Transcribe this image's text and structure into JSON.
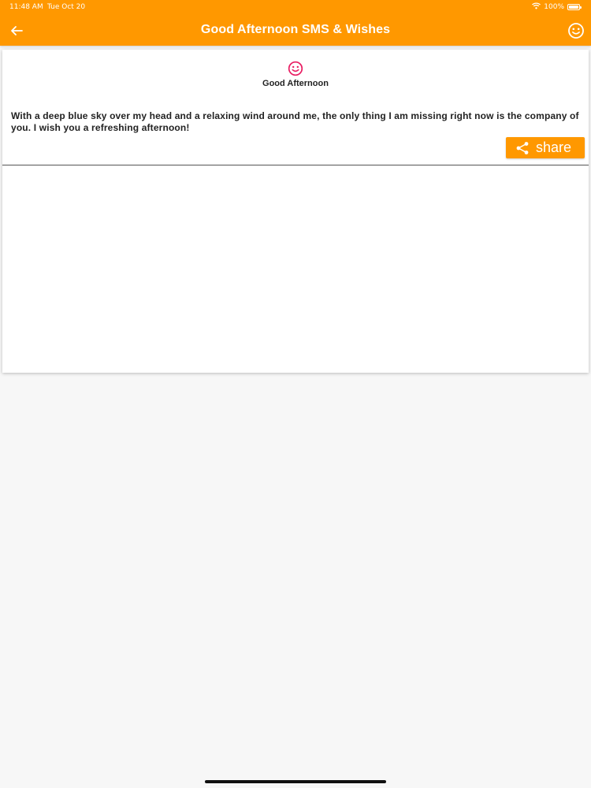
{
  "status_bar": {
    "time": "11:48 AM",
    "date": "Tue Oct 20",
    "battery": "100%"
  },
  "app_bar": {
    "title": "Good Afternoon SMS & Wishes",
    "back_icon": "arrow-left-icon",
    "action_icon": "smiley-icon"
  },
  "card": {
    "icon": "smiley-icon",
    "heading": "Good Afternoon",
    "message": "With a deep blue sky over my head and a relaxing wind around me, the only thing I am missing right now is the company of you. I wish you a refreshing afternoon!",
    "share_label": "share",
    "share_icon": "share-icon"
  },
  "colors": {
    "primary": "#ff9800",
    "accent": "#e91e63",
    "background": "#f7f7f7",
    "card": "#ffffff",
    "text": "#222222"
  }
}
